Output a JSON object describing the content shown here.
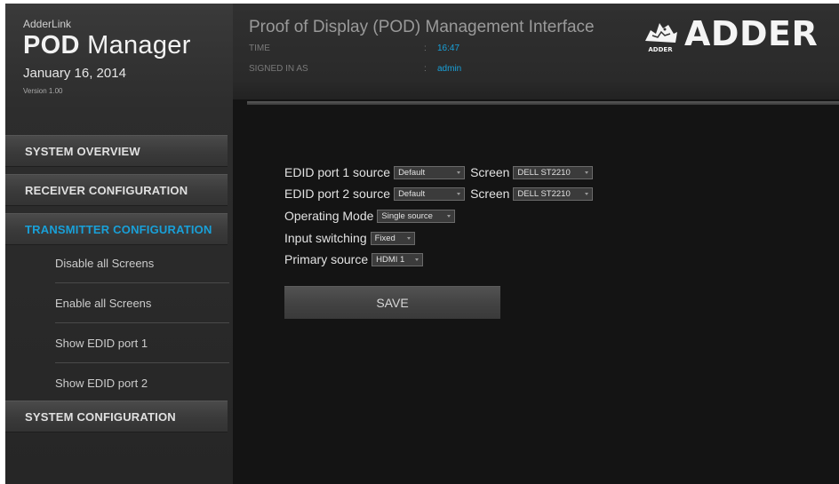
{
  "brand": {
    "small_title": "AdderLink",
    "title_bold": "POD",
    "title_light": "Manager",
    "date": "January 16, 2014",
    "version": "Version 1.00"
  },
  "sidebar": {
    "items": [
      {
        "label": "SYSTEM OVERVIEW"
      },
      {
        "label": "RECEIVER CONFIGURATION"
      },
      {
        "label": "TRANSMITTER CONFIGURATION",
        "active": true
      },
      {
        "label": "SYSTEM CONFIGURATION"
      }
    ],
    "subitems": [
      {
        "label": "Disable all Screens"
      },
      {
        "label": "Enable all Screens"
      },
      {
        "label": "Show EDID port 1"
      },
      {
        "label": "Show EDID port 2"
      }
    ]
  },
  "header": {
    "title": "Proof of Display (POD) Management Interface",
    "time_label": "TIME",
    "time_value": "16:47",
    "signed_label": "SIGNED IN AS",
    "signed_value": "admin",
    "separator": ":",
    "logo_text": "ADDER",
    "logo_mark_text": "ADDER"
  },
  "form": {
    "edid1": {
      "label": "EDID port 1 source",
      "value": "Default",
      "screen_label": "Screen",
      "screen_value": "DELL ST2210"
    },
    "edid2": {
      "label": "EDID port 2 source",
      "value": "Default",
      "screen_label": "Screen",
      "screen_value": "DELL ST2210"
    },
    "operating_mode": {
      "label": "Operating Mode",
      "value": "Single source"
    },
    "input_switching": {
      "label": "Input switching",
      "value": "Fixed"
    },
    "primary_source": {
      "label": "Primary source",
      "value": "HDMI 1"
    },
    "save_label": "SAVE"
  },
  "colors": {
    "accent": "#19a0d8",
    "background": "#141414",
    "sidebar": "#2d2d2d"
  }
}
